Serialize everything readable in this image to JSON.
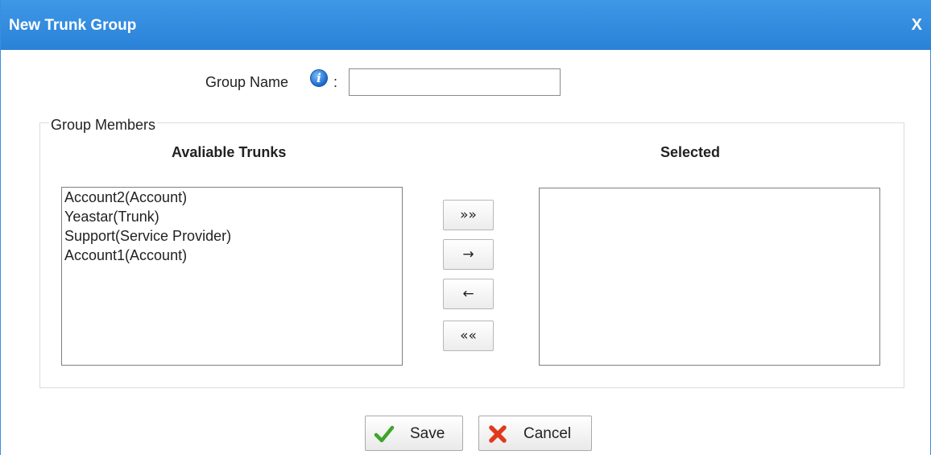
{
  "dialog": {
    "title": "New Trunk Group",
    "close_label": "X"
  },
  "form": {
    "group_name_label": "Group Name",
    "colon": ":",
    "group_name_value": "",
    "group_name_placeholder": ""
  },
  "members": {
    "legend": "Group Members",
    "available_heading": "Avaliable Trunks",
    "selected_heading": "Selected",
    "available_items": [
      "Account2(Account)",
      "Yeastar(Trunk)",
      "Support(Service Provider)",
      "Account1(Account)"
    ],
    "selected_items": []
  },
  "move_buttons": {
    "add_all": "»»",
    "add_one": "→",
    "remove_one": "←",
    "remove_all": "««"
  },
  "actions": {
    "save_label": "Save",
    "cancel_label": "Cancel"
  },
  "colors": {
    "title_bar": "#3f97e6",
    "save_icon": "#3fa52a",
    "cancel_icon": "#e03a1e"
  },
  "icons": {
    "info": "info-icon",
    "save": "checkmark-icon",
    "cancel": "red-x-icon"
  }
}
